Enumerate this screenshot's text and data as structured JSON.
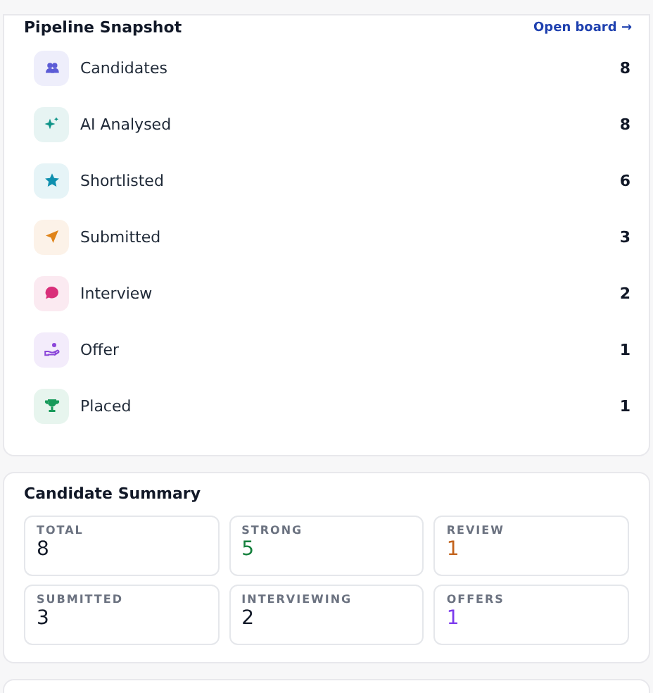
{
  "pipeline": {
    "title": "Pipeline Snapshot",
    "link": "Open board →",
    "stages": [
      {
        "label": "Candidates",
        "count": "8",
        "kind": "people",
        "color": "#5b5bd6"
      },
      {
        "label": "AI Analysed",
        "count": "8",
        "kind": "sparkle",
        "color": "#0f9488"
      },
      {
        "label": "Shortlisted",
        "count": "6",
        "kind": "star",
        "color": "#0e8fae"
      },
      {
        "label": "Submitted",
        "count": "3",
        "kind": "send",
        "color": "#e0841a"
      },
      {
        "label": "Interview",
        "count": "2",
        "kind": "chat",
        "color": "#d92f7a"
      },
      {
        "label": "Offer",
        "count": "1",
        "kind": "hand",
        "color": "#8b46d9"
      },
      {
        "label": "Placed",
        "count": "1",
        "kind": "trophy",
        "color": "#179a5a"
      }
    ]
  },
  "summary": {
    "title": "Candidate Summary",
    "stats": [
      {
        "label": "TOTAL",
        "value": "8",
        "color": "#111827"
      },
      {
        "label": "STRONG",
        "value": "5",
        "color": "#15803d"
      },
      {
        "label": "REVIEW",
        "value": "1",
        "color": "#c2621b"
      },
      {
        "label": "SUBMITTED",
        "value": "3",
        "color": "#111827"
      },
      {
        "label": "INTERVIEWING",
        "value": "2",
        "color": "#111827"
      },
      {
        "label": "OFFERS",
        "value": "1",
        "color": "#7c3aed"
      }
    ]
  }
}
